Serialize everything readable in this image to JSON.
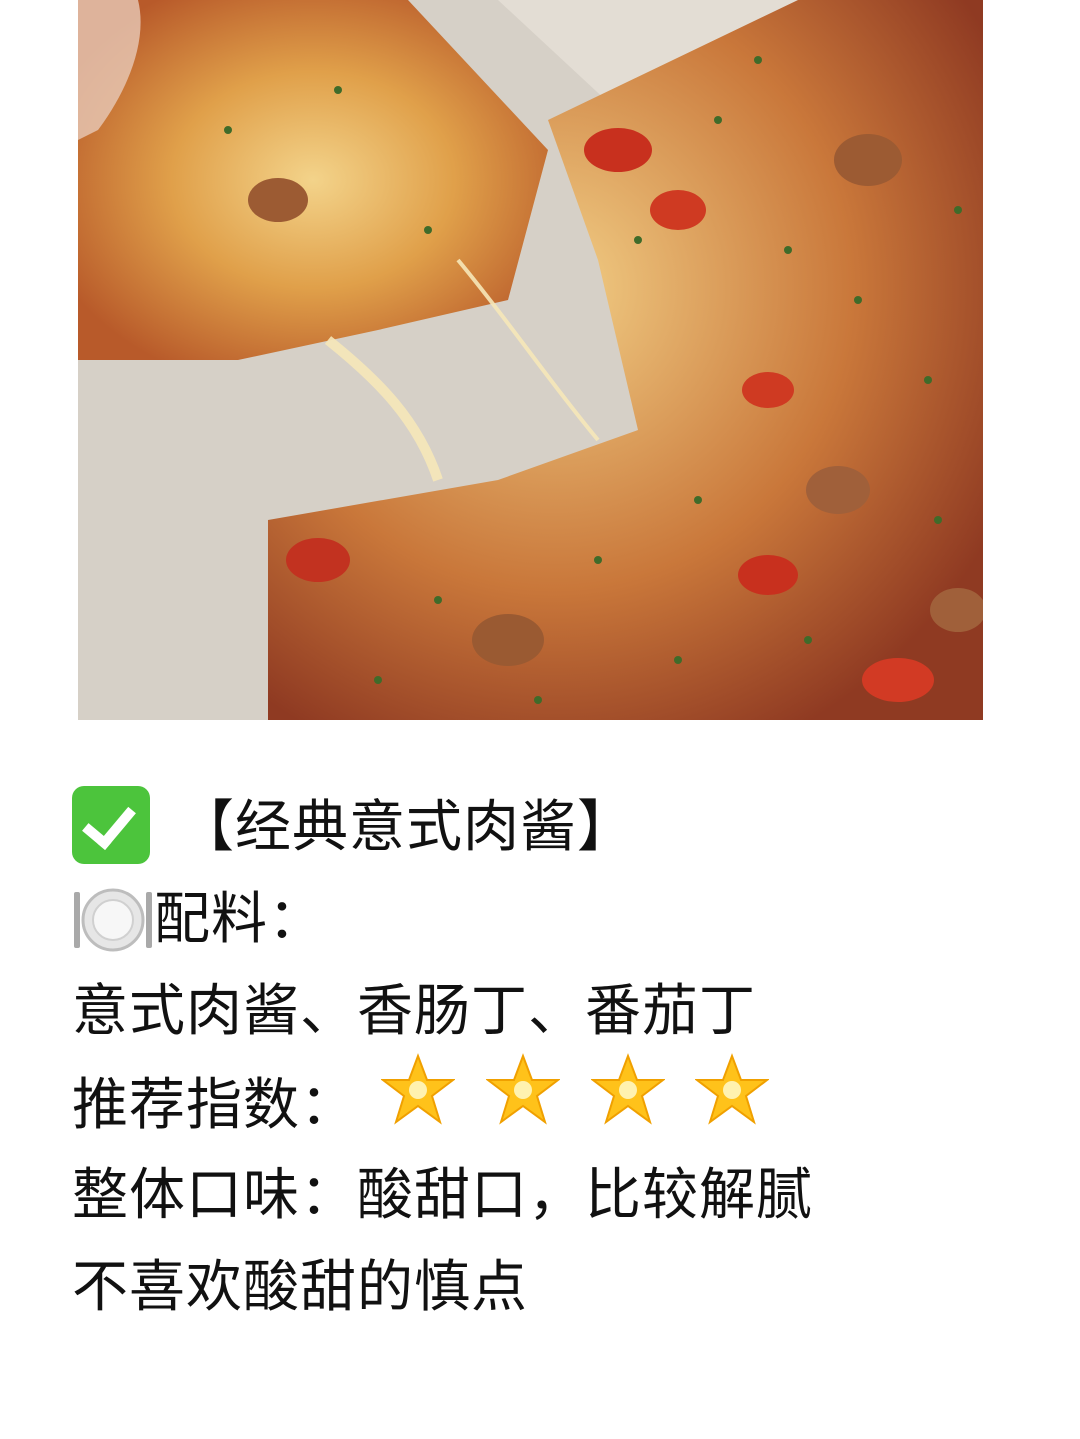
{
  "post": {
    "title": "【经典意式肉酱】",
    "ingredients_label": "配料：",
    "ingredients": "意式肉酱、香肠丁、番茄丁",
    "rating_label": "推荐指数：",
    "rating_stars": 4,
    "taste": "整体口味：酸甜口，比较解腻",
    "note": "不喜欢酸甜的慎点"
  },
  "icons": {
    "title_icon": "check-mark-icon",
    "ingredients_icon": "plate-with-cutlery-icon",
    "rating_icon": "glowing-star-icon"
  },
  "colors": {
    "check_green": "#4cc43c",
    "star_gold": "#ffc21a"
  }
}
